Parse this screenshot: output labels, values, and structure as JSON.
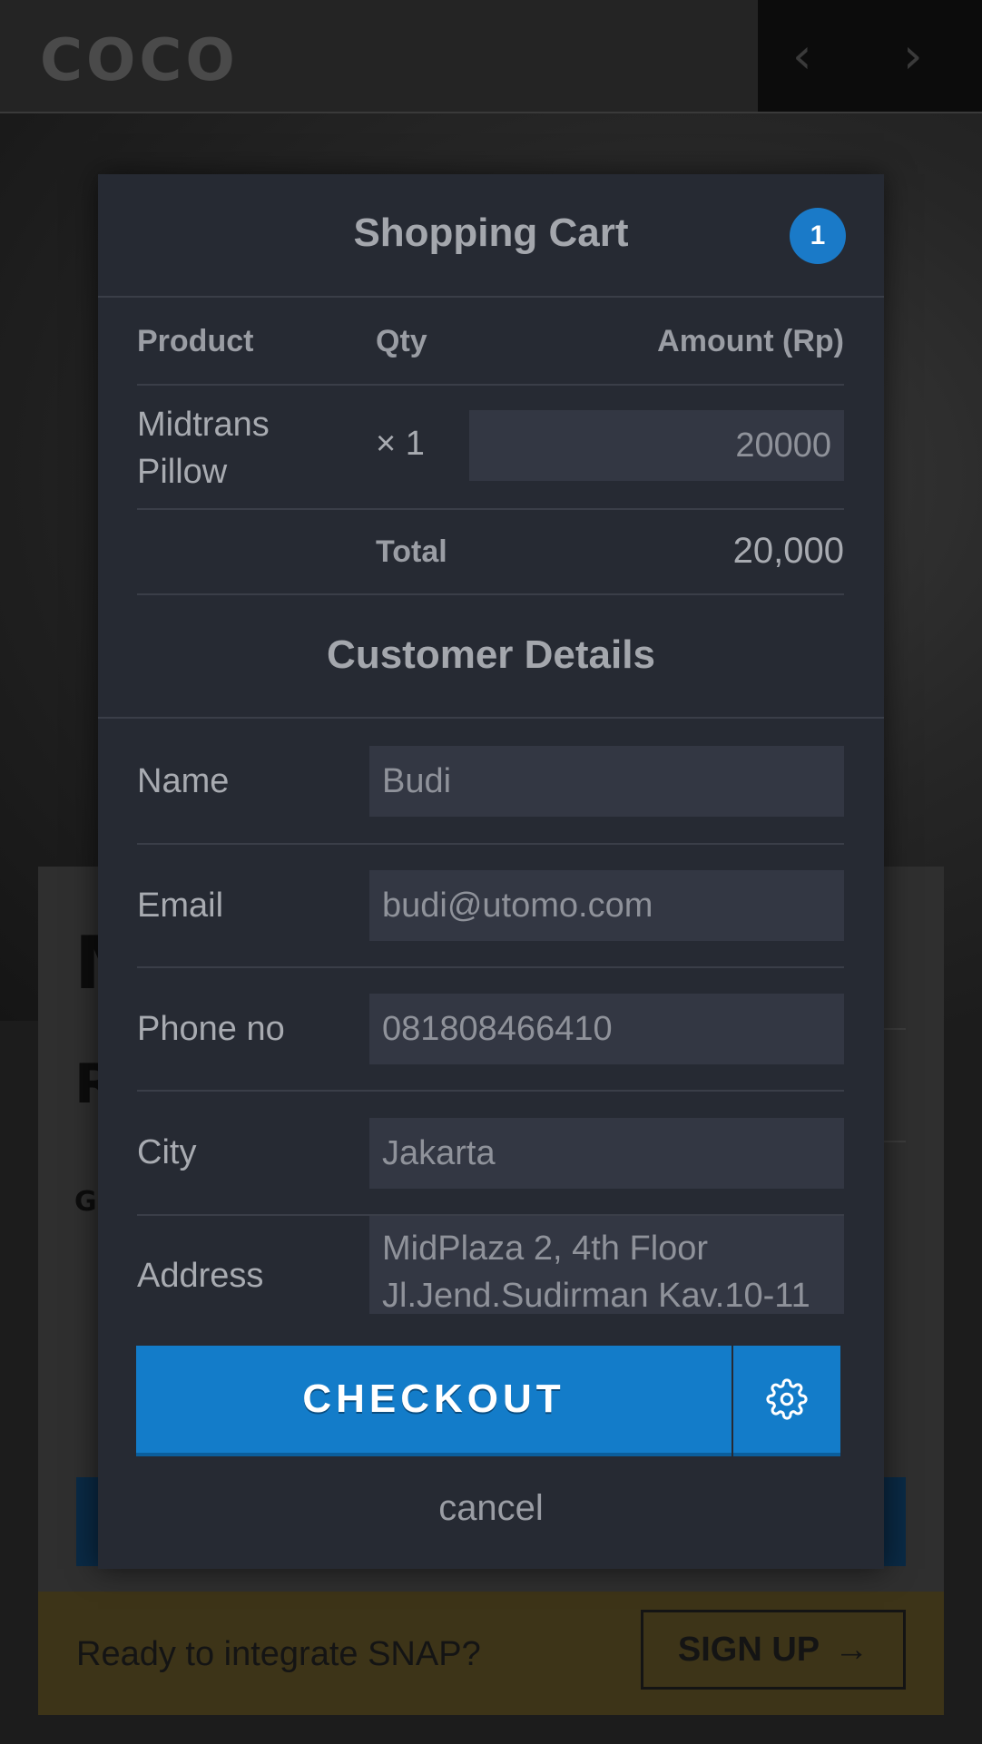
{
  "background": {
    "logo": "COCO",
    "nav_prev": "‹",
    "nav_next": "›",
    "banner_text": "Ready to integrate SNAP?",
    "signup_label": "SIGN UP",
    "signup_arrow": "→"
  },
  "cart": {
    "title": "Shopping Cart",
    "badge_count": "1",
    "columns": {
      "product": "Product",
      "qty": "Qty",
      "amount": "Amount (Rp)"
    },
    "items": [
      {
        "product": "Midtrans Pillow",
        "qty": "× 1",
        "amount": "20000"
      }
    ],
    "total_label": "Total",
    "total_value": "20,000"
  },
  "customer": {
    "title": "Customer Details",
    "fields": [
      {
        "label": "Name",
        "value": "Budi"
      },
      {
        "label": "Email",
        "value": "budi@utomo.com"
      },
      {
        "label": "Phone no",
        "value": "081808466410"
      },
      {
        "label": "City",
        "value": "Jakarta"
      },
      {
        "label": "Address",
        "value": "MidPlaza 2, 4th Floor\nJl.Jend.Sudirman Kav.10-11"
      }
    ]
  },
  "actions": {
    "checkout_label": "CHECKOUT",
    "settings_icon": "gear-icon",
    "cancel_label": "cancel"
  },
  "colors": {
    "accent": "#137cc9",
    "modal_bg": "#262a33",
    "input_bg": "#333743"
  }
}
